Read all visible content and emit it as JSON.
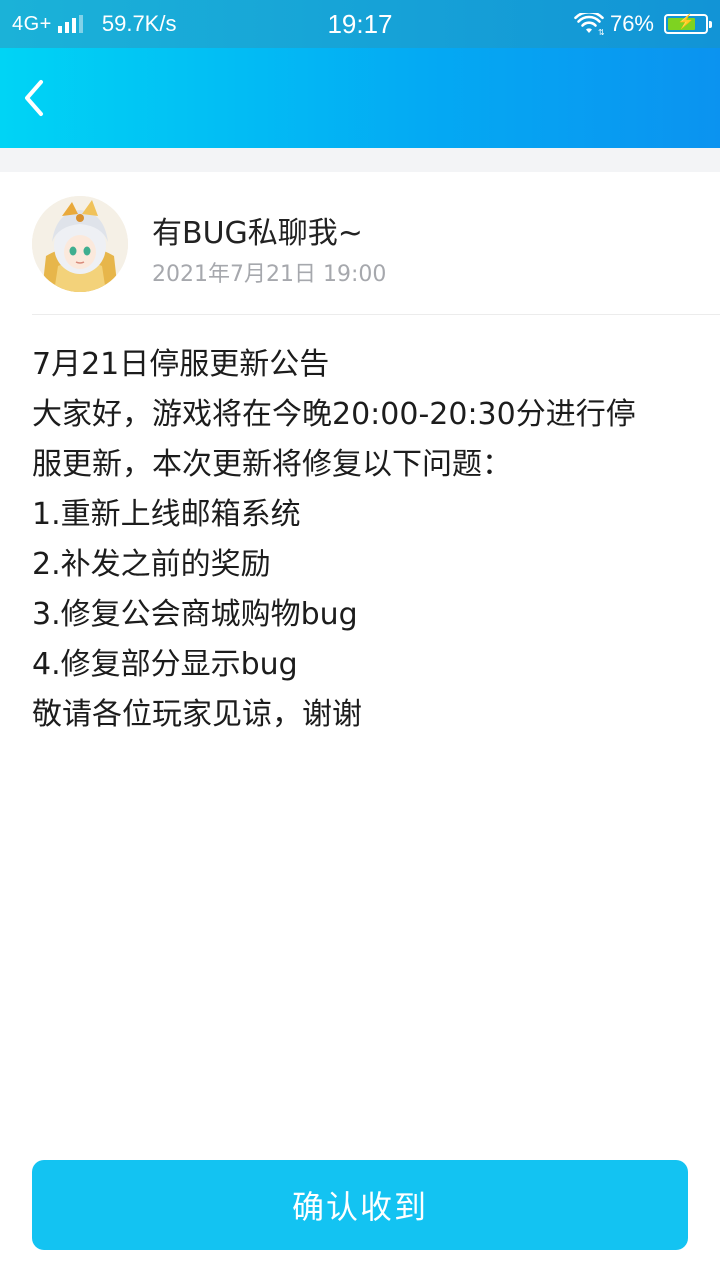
{
  "status_bar": {
    "network": "4G+",
    "speed": "59.7K/s",
    "time": "19:17",
    "battery": "76%",
    "battery_level": 0.76,
    "icons": [
      "signal-icon",
      "wifi-icon",
      "battery-icon",
      "charging-icon"
    ]
  },
  "nav": {
    "back_icon": "chevron-left-icon"
  },
  "post": {
    "author": "有BUG私聊我~",
    "time": "2021年7月21日 19:00",
    "lines": [
      "7月21日停服更新公告",
      "大家好，游戏将在今晚20:00-20:30分进行停",
      "服更新，本次更新将修复以下问题：",
      "1.重新上线邮箱系统",
      "2.补发之前的奖励",
      "3.修复公会商城购物bug",
      "4.修复部分显示bug",
      "敬请各位玩家见谅，谢谢"
    ]
  },
  "confirm_button": {
    "label": "确认收到"
  },
  "colors": {
    "nav_gradient_start": "#00d4f5",
    "nav_gradient_end": "#0b93f0",
    "button": "#13c3f2",
    "timestamp": "#a6a8ad"
  }
}
